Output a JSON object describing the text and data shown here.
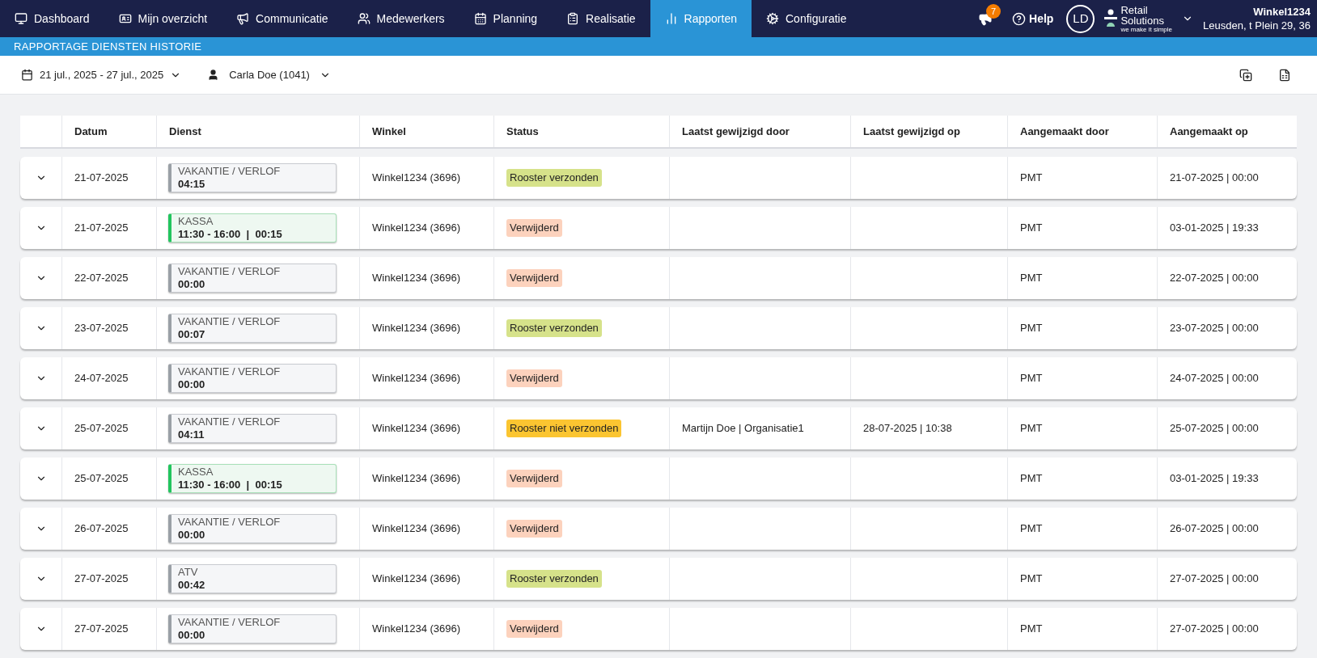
{
  "nav": {
    "items": [
      {
        "label": "Dashboard",
        "selected": false
      },
      {
        "label": "Mijn overzicht",
        "selected": false
      },
      {
        "label": "Communicatie",
        "selected": false
      },
      {
        "label": "Medewerkers",
        "selected": false
      },
      {
        "label": "Planning",
        "selected": false
      },
      {
        "label": "Realisatie",
        "selected": false
      },
      {
        "label": "Rapporten",
        "selected": true
      },
      {
        "label": "Configuratie",
        "selected": false
      }
    ],
    "notification_count": "7",
    "help": "Help",
    "avatar": "LD",
    "logo": {
      "line1": "Retail",
      "line2": "Solutions",
      "tagline": "we make it simple"
    },
    "store": {
      "name": "Winkel1234",
      "address": "Leusden, t Plein 29, 36"
    }
  },
  "page_title": "RAPPORTAGE DIENSTEN HISTORIE",
  "filters": {
    "date_range": "21 jul., 2025 - 27 jul., 2025",
    "employee": "Carla Doe (1041)"
  },
  "table": {
    "columns": [
      "Datum",
      "Dienst",
      "Winkel",
      "Status",
      "Laatst gewijzigd door",
      "Laatst gewijzigd op",
      "Aangemaakt door",
      "Aangemaakt op"
    ],
    "rows": [
      {
        "date": "21-07-2025",
        "shift": {
          "kind": "leave",
          "name": "VAKANTIE / VERLOF",
          "time": "04:15"
        },
        "store": "Winkel1234 (3696)",
        "status": {
          "kind": "sent",
          "label": "Rooster verzonden"
        },
        "modified_by": "",
        "modified_on": "",
        "created_by": "PMT",
        "created_on": "21-07-2025 | 00:00"
      },
      {
        "date": "21-07-2025",
        "shift": {
          "kind": "work",
          "name": "KASSA",
          "time": "11:30 - 16:00  |  00:15"
        },
        "store": "Winkel1234 (3696)",
        "status": {
          "kind": "deleted",
          "label": "Verwijderd"
        },
        "modified_by": "",
        "modified_on": "",
        "created_by": "PMT",
        "created_on": "03-01-2025 | 19:33"
      },
      {
        "date": "22-07-2025",
        "shift": {
          "kind": "leave",
          "name": "VAKANTIE / VERLOF",
          "time": "00:00"
        },
        "store": "Winkel1234 (3696)",
        "status": {
          "kind": "deleted",
          "label": "Verwijderd"
        },
        "modified_by": "",
        "modified_on": "",
        "created_by": "PMT",
        "created_on": "22-07-2025 | 00:00"
      },
      {
        "date": "23-07-2025",
        "shift": {
          "kind": "leave",
          "name": "VAKANTIE / VERLOF",
          "time": "00:07"
        },
        "store": "Winkel1234 (3696)",
        "status": {
          "kind": "sent",
          "label": "Rooster verzonden"
        },
        "modified_by": "",
        "modified_on": "",
        "created_by": "PMT",
        "created_on": "23-07-2025 | 00:00"
      },
      {
        "date": "24-07-2025",
        "shift": {
          "kind": "leave",
          "name": "VAKANTIE / VERLOF",
          "time": "00:00"
        },
        "store": "Winkel1234 (3696)",
        "status": {
          "kind": "deleted",
          "label": "Verwijderd"
        },
        "modified_by": "",
        "modified_on": "",
        "created_by": "PMT",
        "created_on": "24-07-2025 | 00:00"
      },
      {
        "date": "25-07-2025",
        "shift": {
          "kind": "leave",
          "name": "VAKANTIE / VERLOF",
          "time": "04:11"
        },
        "store": "Winkel1234 (3696)",
        "status": {
          "kind": "not_sent",
          "label": "Rooster niet verzonden"
        },
        "modified_by": "Martijn Doe | Organisatie1",
        "modified_on": "28-07-2025 | 10:38",
        "created_by": "PMT",
        "created_on": "25-07-2025 | 00:00"
      },
      {
        "date": "25-07-2025",
        "shift": {
          "kind": "work",
          "name": "KASSA",
          "time": "11:30 - 16:00  |  00:15"
        },
        "store": "Winkel1234 (3696)",
        "status": {
          "kind": "deleted",
          "label": "Verwijderd"
        },
        "modified_by": "",
        "modified_on": "",
        "created_by": "PMT",
        "created_on": "03-01-2025 | 19:33"
      },
      {
        "date": "26-07-2025",
        "shift": {
          "kind": "leave",
          "name": "VAKANTIE / VERLOF",
          "time": "00:00"
        },
        "store": "Winkel1234 (3696)",
        "status": {
          "kind": "deleted",
          "label": "Verwijderd"
        },
        "modified_by": "",
        "modified_on": "",
        "created_by": "PMT",
        "created_on": "26-07-2025 | 00:00"
      },
      {
        "date": "27-07-2025",
        "shift": {
          "kind": "leave",
          "name": "ATV",
          "time": "00:42"
        },
        "store": "Winkel1234 (3696)",
        "status": {
          "kind": "sent",
          "label": "Rooster verzonden"
        },
        "modified_by": "",
        "modified_on": "",
        "created_by": "PMT",
        "created_on": "27-07-2025 | 00:00"
      },
      {
        "date": "27-07-2025",
        "shift": {
          "kind": "leave",
          "name": "VAKANTIE / VERLOF",
          "time": "00:00"
        },
        "store": "Winkel1234 (3696)",
        "status": {
          "kind": "deleted",
          "label": "Verwijderd"
        },
        "modified_by": "",
        "modified_on": "",
        "created_by": "PMT",
        "created_on": "27-07-2025 | 00:00"
      }
    ]
  }
}
